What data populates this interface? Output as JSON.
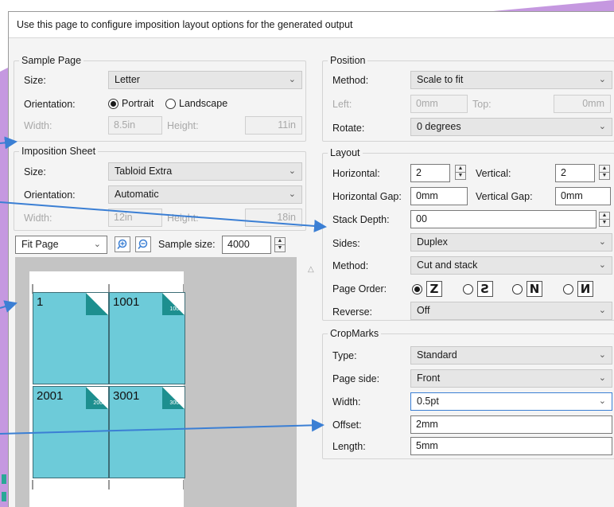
{
  "description": "Use this page to configure imposition layout options for the generated output",
  "sample_page": {
    "legend": "Sample Page",
    "size_label": "Size:",
    "size_value": "Letter",
    "orientation_label": "Orientation:",
    "portrait": "Portrait",
    "landscape": "Landscape",
    "width_label": "Width:",
    "width_value": "8.5in",
    "height_label": "Height:",
    "height_value": "11in"
  },
  "imposition_sheet": {
    "legend": "Imposition Sheet",
    "size_label": "Size:",
    "size_value": "Tabloid Extra",
    "orientation_label": "Orientation:",
    "orientation_value": "Automatic",
    "width_label": "Width:",
    "width_value": "12in",
    "height_label": "Height:",
    "height_value": "18in"
  },
  "preview_toolbar": {
    "zoom_value": "Fit Page",
    "sample_size_label": "Sample size:",
    "sample_size_value": "4000"
  },
  "preview": {
    "tiles": [
      {
        "num": "1",
        "fold": "2"
      },
      {
        "num": "1001",
        "fold": "1002"
      },
      {
        "num": "2001",
        "fold": "2002"
      },
      {
        "num": "3001",
        "fold": "3002"
      }
    ]
  },
  "position": {
    "legend": "Position",
    "method_label": "Method:",
    "method_value": "Scale to fit",
    "left_label": "Left:",
    "left_value": "0mm",
    "top_label": "Top:",
    "top_value": "0mm",
    "rotate_label": "Rotate:",
    "rotate_value": "0 degrees"
  },
  "layout": {
    "legend": "Layout",
    "horizontal_label": "Horizontal:",
    "horizontal_value": "2",
    "vertical_label": "Vertical:",
    "vertical_value": "2",
    "hgap_label": "Horizontal Gap:",
    "hgap_value": "0mm",
    "vgap_label": "Vertical Gap:",
    "vgap_value": "0mm",
    "stack_label": "Stack Depth:",
    "stack_value": "00",
    "sides_label": "Sides:",
    "sides_value": "Duplex",
    "method_label": "Method:",
    "method_value": "Cut and stack",
    "page_order_label": "Page Order:",
    "reverse_label": "Reverse:",
    "reverse_value": "Off"
  },
  "cropmarks": {
    "legend": "CropMarks",
    "type_label": "Type:",
    "type_value": "Standard",
    "side_label": "Page side:",
    "side_value": "Front",
    "width_label": "Width:",
    "width_value": "0.5pt",
    "offset_label": "Offset:",
    "offset_value": "2mm",
    "length_label": "Length:",
    "length_value": "5mm"
  },
  "colors": {
    "accent": "#3b7fd4",
    "tile": "#6dcbd9",
    "fold": "#1d8f8f",
    "background_deco": "#c598e0"
  }
}
